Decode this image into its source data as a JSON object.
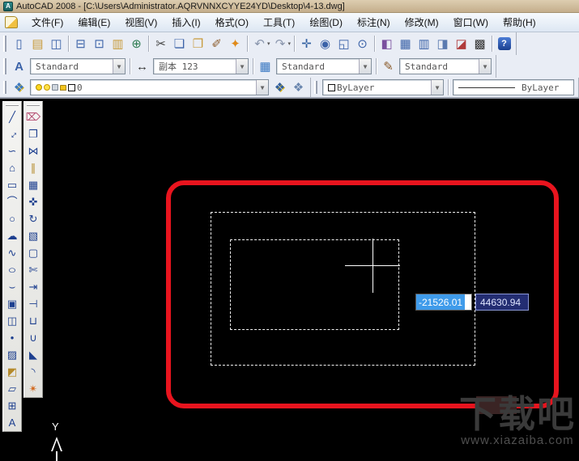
{
  "window": {
    "title": "AutoCAD 2008 - [C:\\Users\\Administrator.AQRVNNXCYYE24YD\\Desktop\\4-13.dwg]",
    "app_icon": "autocad-logo"
  },
  "menu": {
    "items": [
      "文件(F)",
      "编辑(E)",
      "视图(V)",
      "插入(I)",
      "格式(O)",
      "工具(T)",
      "绘图(D)",
      "标注(N)",
      "修改(M)",
      "窗口(W)",
      "帮助(H)"
    ]
  },
  "standard_toolbar": {
    "groups": [
      [
        {
          "name": "new",
          "glyph": "▯"
        },
        {
          "name": "open",
          "glyph": "▤",
          "color": "#c79a3a"
        },
        {
          "name": "save",
          "glyph": "◫"
        }
      ],
      [
        {
          "name": "plot",
          "glyph": "⊟"
        },
        {
          "name": "plot-preview",
          "glyph": "⊡"
        },
        {
          "name": "publish",
          "glyph": "▥",
          "color": "#c79a3a"
        },
        {
          "name": "publish-web",
          "glyph": "⊕",
          "color": "#2e7d52"
        }
      ],
      [
        {
          "name": "cut",
          "glyph": "✂",
          "color": "#444444"
        },
        {
          "name": "copy",
          "glyph": "❏"
        },
        {
          "name": "paste",
          "glyph": "❐",
          "color": "#c79a3a"
        },
        {
          "name": "match-properties",
          "glyph": "✐",
          "color": "#8a5a2a"
        },
        {
          "name": "block-editor",
          "glyph": "✦",
          "color": "#e08a1a"
        }
      ],
      [
        {
          "name": "undo",
          "glyph": "↶",
          "color": "#8a96ad",
          "dropdown": true
        },
        {
          "name": "redo",
          "glyph": "↷",
          "color": "#8a96ad",
          "dropdown": true
        }
      ],
      [
        {
          "name": "pan",
          "glyph": "✛",
          "color": "#2f5fa0"
        },
        {
          "name": "zoom-realtime",
          "glyph": "◉"
        },
        {
          "name": "zoom-window",
          "glyph": "◱"
        },
        {
          "name": "zoom-previous",
          "glyph": "⊙"
        }
      ],
      [
        {
          "name": "properties",
          "glyph": "◧",
          "color": "#7a4f9e"
        },
        {
          "name": "designcenter",
          "glyph": "▦"
        },
        {
          "name": "tool-palettes",
          "glyph": "▥"
        },
        {
          "name": "sheetset-manager",
          "glyph": "◨",
          "color": "#5a7ab0"
        },
        {
          "name": "markup-set-manager",
          "glyph": "◪",
          "color": "#b03a3a"
        },
        {
          "name": "quickcalc",
          "glyph": "▩",
          "color": "#333333"
        }
      ],
      [
        {
          "name": "help",
          "glyph": "?",
          "help": true
        }
      ]
    ]
  },
  "styles_toolbar": {
    "text_style": {
      "icon": "text-style-icon",
      "icon_glyph": "A",
      "value": "Standard"
    },
    "dim_style": {
      "icon": "dim-style-icon",
      "icon_glyph": "↔",
      "value": "副本 123"
    },
    "table_style": {
      "icon": "table-style-icon",
      "icon_glyph": "▦",
      "value": "Standard"
    },
    "mleader_style": {
      "icon": "mleader-style-icon",
      "icon_glyph": "✎",
      "value": "Standard"
    }
  },
  "layers_toolbar": {
    "manager_icon": "layer-properties-manager",
    "manager_glyph": "❖",
    "layer_value": "0",
    "state_icons": [
      "bulb",
      "freeze",
      "plot",
      "lock",
      "color-swatch"
    ],
    "make_current_glyph": "❖",
    "previous_glyph": "❖"
  },
  "properties_toolbar": {
    "color_value": "ByLayer",
    "linetype_value": "ByLayer"
  },
  "draw_toolbar": [
    {
      "name": "line",
      "glyph": "╱"
    },
    {
      "name": "construction-line",
      "glyph": "↔",
      "rot": -45
    },
    {
      "name": "polyline",
      "glyph": "∽"
    },
    {
      "name": "polygon",
      "glyph": "⌂"
    },
    {
      "name": "rectangle",
      "glyph": "▭"
    },
    {
      "name": "arc",
      "glyph": "⌒"
    },
    {
      "name": "circle",
      "glyph": "○"
    },
    {
      "name": "revision-cloud",
      "glyph": "☁"
    },
    {
      "name": "spline",
      "glyph": "∿"
    },
    {
      "name": "ellipse",
      "glyph": "○",
      "sx": 1.35
    },
    {
      "name": "ellipse-arc",
      "glyph": "⌣"
    },
    {
      "name": "insert-block",
      "glyph": "▣"
    },
    {
      "name": "make-block",
      "glyph": "◫"
    },
    {
      "name": "point",
      "glyph": "•"
    },
    {
      "name": "hatch",
      "glyph": "▨"
    },
    {
      "name": "gradient",
      "glyph": "◩",
      "color": "#b58a2a"
    },
    {
      "name": "region",
      "glyph": "▱"
    },
    {
      "name": "table",
      "glyph": "⊞"
    },
    {
      "name": "mtext",
      "glyph": "A"
    }
  ],
  "modify_toolbar": [
    {
      "name": "erase",
      "glyph": "⌦",
      "color": "#b3486e"
    },
    {
      "name": "copy",
      "glyph": "❐"
    },
    {
      "name": "mirror",
      "glyph": "⋈"
    },
    {
      "name": "offset",
      "glyph": "∥",
      "color": "#b58a2a"
    },
    {
      "name": "array",
      "glyph": "▦"
    },
    {
      "name": "move",
      "glyph": "✜"
    },
    {
      "name": "rotate",
      "glyph": "↻"
    },
    {
      "name": "scale",
      "glyph": "▧"
    },
    {
      "name": "stretch",
      "glyph": "▢"
    },
    {
      "name": "trim",
      "glyph": "✄"
    },
    {
      "name": "extend",
      "glyph": "⇥"
    },
    {
      "name": "break-at-point",
      "glyph": "⊣"
    },
    {
      "name": "break",
      "glyph": "⊔"
    },
    {
      "name": "join",
      "glyph": "∪"
    },
    {
      "name": "chamfer",
      "glyph": "◣"
    },
    {
      "name": "fillet",
      "glyph": "◝"
    },
    {
      "name": "explode",
      "glyph": "✴",
      "color": "#d2691e"
    }
  ],
  "canvas": {
    "dynamic_input": {
      "x_value": "-21526.01",
      "y_value": "44630.94"
    },
    "ucs_label": "Y",
    "watermark": {
      "title": "下载吧",
      "url": "www.xiazaiba.com"
    },
    "colors": {
      "background": "#000000",
      "selection_rect_red": "#e8141e",
      "dashed_white": "#f2f2f2",
      "input_selection_blue": "#3f9bea",
      "input_navy": "#232d72"
    }
  }
}
